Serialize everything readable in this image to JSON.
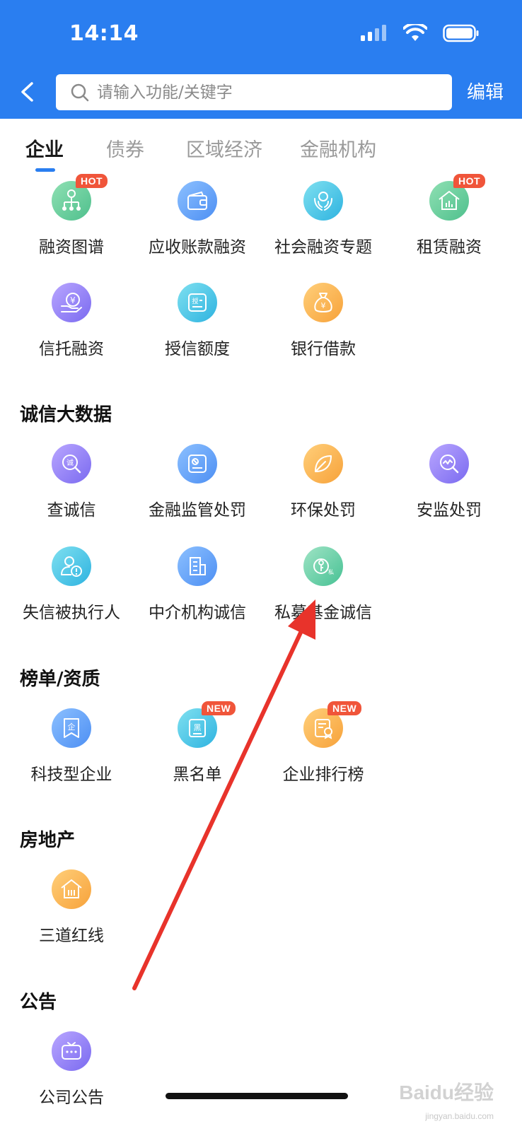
{
  "status_bar": {
    "time": "14:14"
  },
  "header": {
    "search_placeholder": "请输入功能/关键字",
    "edit_label": "编辑"
  },
  "tabs": [
    {
      "label": "企业",
      "active": true
    },
    {
      "label": "债券",
      "active": false
    },
    {
      "label": "区域经济",
      "active": false
    },
    {
      "label": "金融机构",
      "active": false
    }
  ],
  "financing": {
    "items": [
      {
        "label": "融资图谱",
        "icon": "financing-map-icon",
        "badge": "HOT"
      },
      {
        "label": "应收账款融资",
        "icon": "wallet-icon",
        "badge": ""
      },
      {
        "label": "社会融资专题",
        "icon": "hands-icon",
        "badge": ""
      },
      {
        "label": "租赁融资",
        "icon": "house-chart-icon",
        "badge": "HOT"
      },
      {
        "label": "信托融资",
        "icon": "trust-yuan-icon",
        "badge": ""
      },
      {
        "label": "授信额度",
        "icon": "credit-card-icon",
        "badge": ""
      },
      {
        "label": "银行借款",
        "icon": "money-bag-icon",
        "badge": ""
      }
    ]
  },
  "credit": {
    "title": "诚信大数据",
    "items": [
      {
        "label": "查诚信",
        "icon": "search-integrity-icon"
      },
      {
        "label": "金融监管处罚",
        "icon": "regulation-icon"
      },
      {
        "label": "环保处罚",
        "icon": "leaf-icon"
      },
      {
        "label": "安监处罚",
        "icon": "safety-search-icon"
      },
      {
        "label": "失信被执行人",
        "icon": "person-alert-icon"
      },
      {
        "label": "中介机构诚信",
        "icon": "building-icon"
      },
      {
        "label": "私募基金诚信",
        "icon": "private-fund-icon"
      }
    ]
  },
  "rankings": {
    "title": "榜单/资质",
    "items": [
      {
        "label": "科技型企业",
        "icon": "enterprise-badge-icon",
        "badge": ""
      },
      {
        "label": "黑名单",
        "icon": "blacklist-icon",
        "badge": "NEW"
      },
      {
        "label": "企业排行榜",
        "icon": "ranking-certificate-icon",
        "badge": "NEW"
      }
    ]
  },
  "real_estate": {
    "title": "房地产",
    "items": [
      {
        "label": "三道红线",
        "icon": "house-bars-icon"
      }
    ]
  },
  "announcement": {
    "title": "公告",
    "items": [
      {
        "label": "公司公告",
        "icon": "chat-bubble-icon"
      }
    ]
  },
  "watermark": {
    "text": "Baidu经验",
    "sub": "jingyan.baidu.com"
  },
  "colors": {
    "header_blue": "#2a7ef0",
    "badge_red": "#f0553a",
    "annotation_arrow": "#e8332b"
  }
}
